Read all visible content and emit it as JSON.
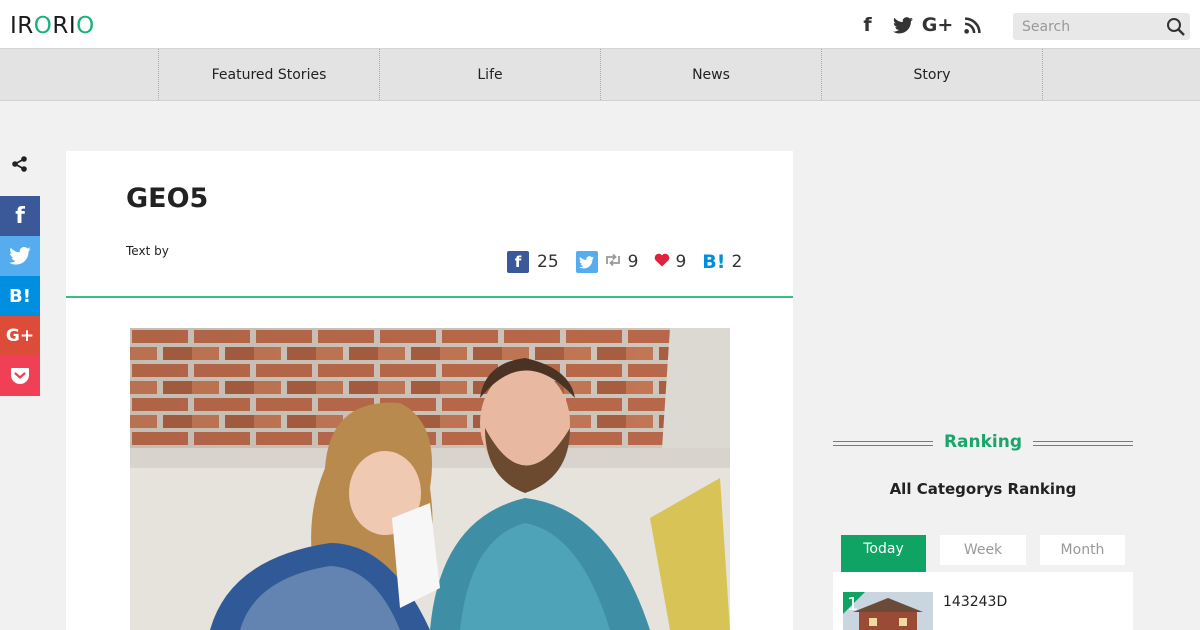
{
  "header": {
    "logo": {
      "part1": "IR",
      "part2": "O",
      "part3": "RI",
      "part4": "O"
    },
    "social": [
      {
        "icon": "facebook-icon",
        "glyph": "f"
      },
      {
        "icon": "twitter-icon",
        "glyph": ""
      },
      {
        "icon": "google-plus-icon",
        "glyph": "G+"
      },
      {
        "icon": "rss-icon",
        "glyph": ""
      }
    ],
    "search_placeholder": "Search"
  },
  "nav": {
    "tabs": [
      "Featured Stories",
      "Life",
      "News",
      "Story"
    ]
  },
  "share_rail": {
    "buttons": [
      {
        "icon": "facebook-icon",
        "glyph": "f",
        "color": "#3b5998"
      },
      {
        "icon": "twitter-icon",
        "glyph": "",
        "color": "#55acee"
      },
      {
        "icon": "hatena-bookmark-icon",
        "glyph": "B!",
        "color": "#008fde"
      },
      {
        "icon": "google-plus-icon",
        "glyph": "G+",
        "color": "#dd4b39"
      },
      {
        "icon": "pocket-icon",
        "glyph": "",
        "color": "#ef4056"
      }
    ]
  },
  "article": {
    "title": "GEO5",
    "byline": "Text by",
    "counts": {
      "facebook": "25",
      "retweet": "9",
      "like": "9",
      "hatena": "2"
    }
  },
  "sidebar": {
    "ranking_title": "Ranking",
    "ranking_subtitle": "All Categorys Ranking",
    "tabs": [
      "Today",
      "Week",
      "Month"
    ],
    "active_tab": "Today",
    "items": [
      {
        "rank": "1",
        "name": "143243D"
      }
    ]
  },
  "colors": {
    "accent": "#16b378",
    "divider": "#34c17e",
    "ranking_green": "#0fa464",
    "facebook": "#3b5998",
    "twitter": "#55acee",
    "hatena": "#008fde",
    "heart": "#e0223c"
  }
}
